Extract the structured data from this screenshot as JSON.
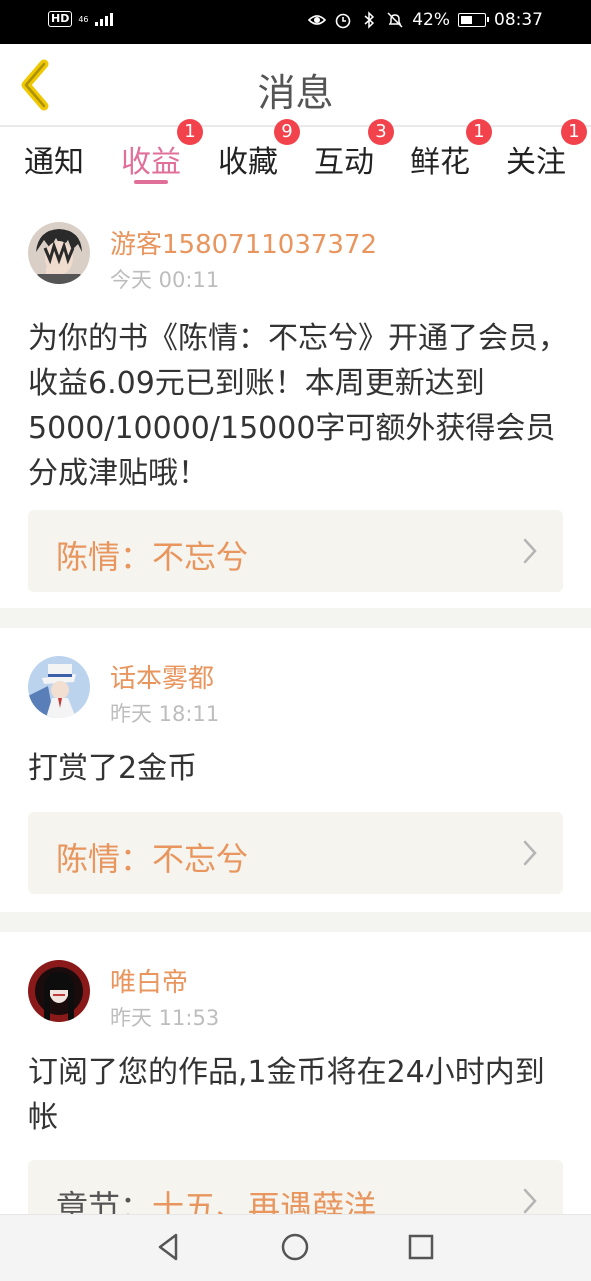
{
  "status_bar": {
    "hd": "HD",
    "network": "46",
    "battery": "42%",
    "time": "08:37"
  },
  "header": {
    "title": "消息"
  },
  "tabs": [
    {
      "label": "通知",
      "badge": ""
    },
    {
      "label": "收益",
      "badge": "1",
      "active": true
    },
    {
      "label": "收藏",
      "badge": "9"
    },
    {
      "label": "互动",
      "badge": "3"
    },
    {
      "label": "鲜花",
      "badge": "1"
    },
    {
      "label": "关注",
      "badge": "1"
    }
  ],
  "messages": [
    {
      "user": "游客1580711037372",
      "time": "今天 00:11",
      "text": "为你的书《陈情：不忘兮》开通了会员，收益6.09元已到账！本周更新达到5000/10000/15000字可额外获得会员分成津贴哦！",
      "link": {
        "prefix": "",
        "label": "陈情：不忘兮"
      }
    },
    {
      "user": "话本雾都",
      "time": "昨天 18:11",
      "text": "打赏了2金币",
      "link": {
        "prefix": "",
        "label": "陈情：不忘兮"
      }
    },
    {
      "user": "唯白帝",
      "time": "昨天 11:53",
      "text": "订阅了您的作品,1金币将在24小时内到帐",
      "link": {
        "prefix": "章节：",
        "label": "十五、再遇薛洋"
      }
    }
  ],
  "colors": {
    "accent": "#e0709a",
    "username": "#e8955e",
    "badge": "#f2434d",
    "back_arrow": "#f0c800"
  }
}
